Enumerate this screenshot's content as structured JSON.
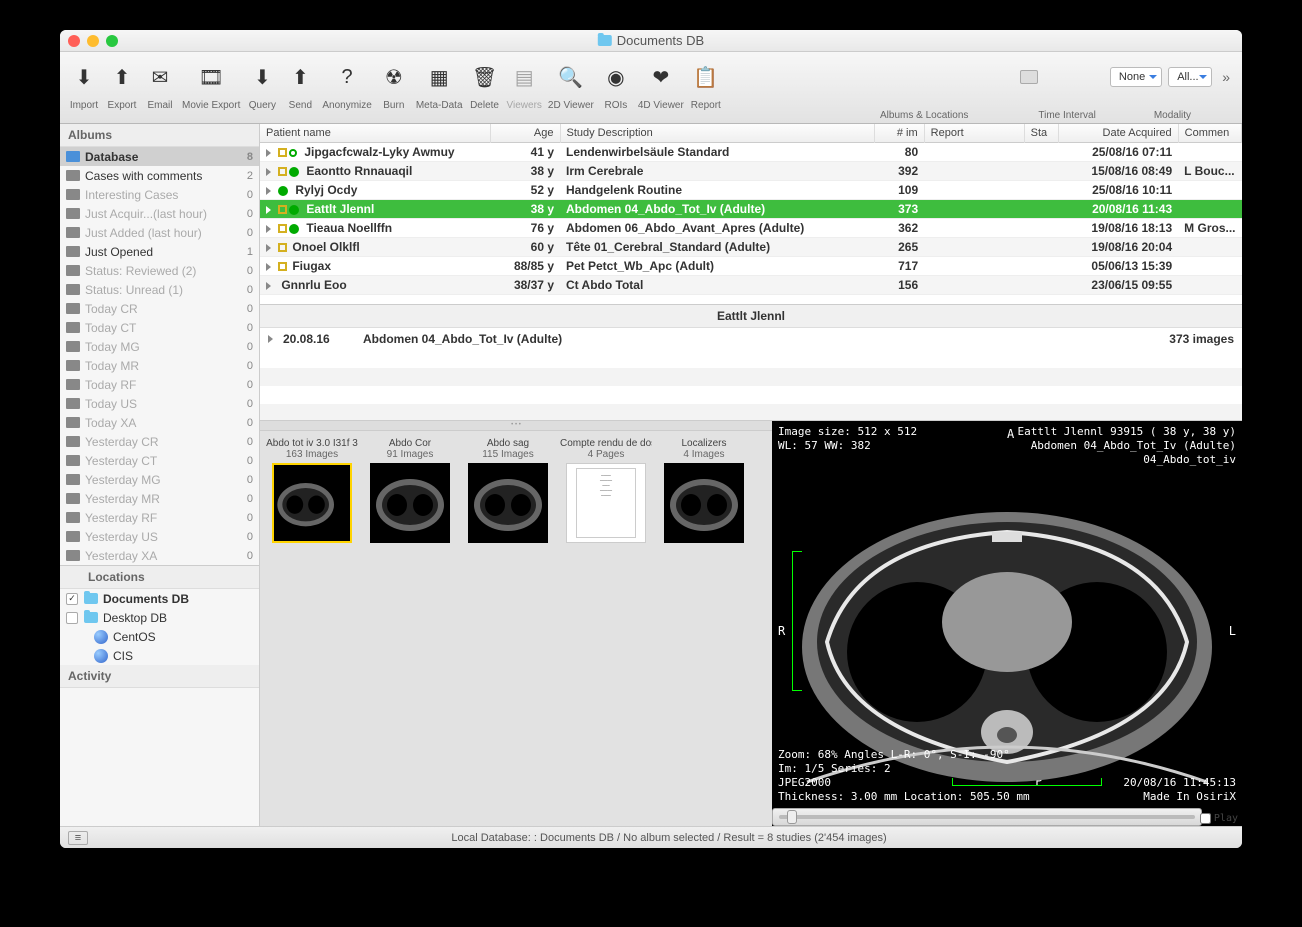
{
  "window_title": "Documents DB",
  "toolbar": {
    "items": [
      {
        "label": "Import",
        "icon": "import"
      },
      {
        "label": "Export",
        "icon": "export"
      },
      {
        "label": "Email",
        "icon": "email"
      },
      {
        "label": "Movie Export",
        "icon": "movie"
      },
      {
        "label": "Query",
        "icon": "query"
      },
      {
        "label": "Send",
        "icon": "send"
      },
      {
        "label": "Anonymize",
        "icon": "anon"
      },
      {
        "label": "Burn",
        "icon": "burn"
      },
      {
        "label": "Meta-Data",
        "icon": "meta"
      },
      {
        "label": "Delete",
        "icon": "delete"
      },
      {
        "label": "Viewers",
        "icon": "viewers",
        "dim": true
      },
      {
        "label": "2D Viewer",
        "icon": "2d"
      },
      {
        "label": "ROIs",
        "icon": "rois"
      },
      {
        "label": "4D Viewer",
        "icon": "4d"
      },
      {
        "label": "Report",
        "icon": "report"
      }
    ],
    "right_selects": {
      "none": "None",
      "all": "All..."
    },
    "bottom_groups": [
      "Albums & Locations",
      "Time Interval",
      "Modality"
    ]
  },
  "sidebar": {
    "albums_header": "Albums",
    "albums": [
      {
        "name": "Database",
        "count": "8",
        "sel": true,
        "icon": "db"
      },
      {
        "name": "Cases with comments",
        "count": "2"
      },
      {
        "name": "Interesting Cases",
        "count": "0",
        "dim": true
      },
      {
        "name": "Just Acquir...(last hour)",
        "count": "0",
        "dim": true
      },
      {
        "name": "Just Added (last hour)",
        "count": "0",
        "dim": true
      },
      {
        "name": "Just Opened",
        "count": "1"
      },
      {
        "name": "Status: Reviewed (2)",
        "count": "0",
        "dim": true
      },
      {
        "name": "Status: Unread (1)",
        "count": "0",
        "dim": true
      },
      {
        "name": "Today CR",
        "count": "0",
        "dim": true
      },
      {
        "name": "Today CT",
        "count": "0",
        "dim": true
      },
      {
        "name": "Today MG",
        "count": "0",
        "dim": true
      },
      {
        "name": "Today MR",
        "count": "0",
        "dim": true
      },
      {
        "name": "Today RF",
        "count": "0",
        "dim": true
      },
      {
        "name": "Today US",
        "count": "0",
        "dim": true
      },
      {
        "name": "Today XA",
        "count": "0",
        "dim": true
      },
      {
        "name": "Yesterday CR",
        "count": "0",
        "dim": true
      },
      {
        "name": "Yesterday CT",
        "count": "0",
        "dim": true
      },
      {
        "name": "Yesterday MG",
        "count": "0",
        "dim": true
      },
      {
        "name": "Yesterday MR",
        "count": "0",
        "dim": true
      },
      {
        "name": "Yesterday RF",
        "count": "0",
        "dim": true
      },
      {
        "name": "Yesterday US",
        "count": "0",
        "dim": true
      },
      {
        "name": "Yesterday XA",
        "count": "0",
        "dim": true
      }
    ],
    "locations_header": "Locations",
    "locations": [
      {
        "name": "Documents DB",
        "checked": true,
        "bold": true,
        "icon": "folder"
      },
      {
        "name": "Desktop DB",
        "checked": false,
        "icon": "folder"
      },
      {
        "name": "CentOS",
        "icon": "globe",
        "indent": true
      },
      {
        "name": "CIS",
        "icon": "globe",
        "indent": true
      }
    ],
    "activity_header": "Activity"
  },
  "columns": {
    "c0": "Patient name",
    "c1": "Age",
    "c2": "Study Description",
    "c3": "# im",
    "c4": "Report",
    "c5": "Sta",
    "c6": "Date Acquired",
    "c7": "Commen"
  },
  "studies": [
    {
      "name": "Jipgacfcwalz-Lyky Awmuy",
      "age": "41 y",
      "desc": "Lendenwirbelsäule Standard",
      "im": "80",
      "date": "25/08/16 07:11",
      "comm": "",
      "box": true,
      "circ": "o"
    },
    {
      "name": "Eaontto Rnnauaqil",
      "age": "38 y",
      "desc": "Irm Cerebrale",
      "im": "392",
      "date": "15/08/16 08:49",
      "comm": "L Bouc...",
      "box": true,
      "circ": "g"
    },
    {
      "name": "Rylyj Ocdy",
      "age": "52 y",
      "desc": "Handgelenk Routine",
      "im": "109",
      "date": "25/08/16 10:11",
      "comm": "",
      "circ": "g"
    },
    {
      "name": "Eattlt Jlennl",
      "age": "38 y",
      "desc": "Abdomen 04_Abdo_Tot_Iv (Adulte)",
      "im": "373",
      "date": "20/08/16 11:43",
      "comm": "",
      "box": true,
      "circ": "g",
      "sel": true
    },
    {
      "name": "Tieaua Noellffn",
      "age": "76 y",
      "desc": "Abdomen 06_Abdo_Avant_Apres (Adulte)",
      "im": "362",
      "date": "19/08/16 18:13",
      "comm": "M Gros...",
      "box": true,
      "circ": "g"
    },
    {
      "name": "Onoel Olklfl",
      "age": "60 y",
      "desc": "Tête 01_Cerebral_Standard (Adulte)",
      "im": "265",
      "date": "19/08/16 20:04",
      "comm": "",
      "box": true
    },
    {
      "name": "Fiugax",
      "age": "88/85 y",
      "desc": "Pet Petct_Wb_Apc (Adult)",
      "im": "717",
      "date": "05/06/13 15:39",
      "comm": "",
      "box": true
    },
    {
      "name": "Gnnrlu Eoo",
      "age": "38/37 y",
      "desc": "Ct Abdo Total",
      "im": "156",
      "date": "23/06/15 09:55",
      "comm": ""
    }
  ],
  "series_header": "Eattlt Jlennl",
  "series_row": {
    "date": "20.08.16",
    "desc": "Abdomen 04_Abdo_Tot_Iv (Adulte)",
    "count": "373 images"
  },
  "thumbs": [
    {
      "name": "Abdo tot iv 3.0 I31f 3",
      "count": "163 Images",
      "sel": true
    },
    {
      "name": "Abdo Cor",
      "count": "91 Images"
    },
    {
      "name": "Abdo sag",
      "count": "115 Images"
    },
    {
      "name": "Compte rendu de dose",
      "count": "4 Pages",
      "doc": true
    },
    {
      "name": "Localizers",
      "count": "4 Images"
    }
  ],
  "viewer": {
    "img_size": "Image size: 512 x 512",
    "wl": "WL: 57 WW: 382",
    "patient": "Eattlt Jlennl 93915 ( 38 y,  38 y)",
    "study": "Abdomen 04_Abdo_Tot_Iv (Adulte)",
    "series": "04_Abdo_tot_iv",
    "zoom": "Zoom: 68% Angles L-R: 0°, S-I: -90°",
    "im": "Im: 1/5 Series: 2",
    "comp": "JPEG2000",
    "thick": "Thickness: 3.00 mm Location: 505.50 mm",
    "dt": "20/08/16 11:45:13",
    "made": "Made In OsiriX",
    "A": "A",
    "P": "P",
    "R": "R",
    "L": "L",
    "play": "Play"
  },
  "status": "Local Database: : Documents DB / No album selected / Result = 8 studies (2'454 images)"
}
